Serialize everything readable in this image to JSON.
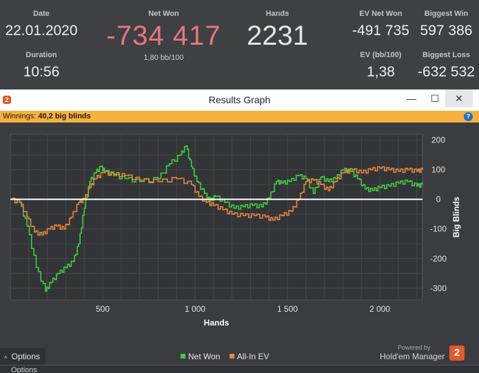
{
  "stats": {
    "date": {
      "label": "Date",
      "value": "22.01.2020"
    },
    "duration": {
      "label": "Duration",
      "value": "10:56"
    },
    "net_won": {
      "label": "Net Won",
      "value": "-734 417",
      "sub": "1,80 bb/100"
    },
    "hands": {
      "label": "Hands",
      "value": "2231"
    },
    "ev_net_won": {
      "label": "EV Net Won",
      "value": "-491 735"
    },
    "biggest_win": {
      "label": "Biggest Win",
      "value": "597 386"
    },
    "ev_bb100": {
      "label": "EV (bb/100)",
      "value": "1,38"
    },
    "biggest_loss": {
      "label": "Biggest Loss",
      "value": "-632 532"
    }
  },
  "window": {
    "title": "Results Graph",
    "app_icon": "2",
    "min_glyph": "—",
    "max_glyph": "☐",
    "close_glyph": "✕"
  },
  "winnings_bar": {
    "label": "Winnings:",
    "value": "40,2 big blinds",
    "help_glyph": "?"
  },
  "legend": {
    "net_won": "Net Won",
    "all_in_ev": "All-In EV"
  },
  "branding": {
    "powered": "Powered by",
    "name": "Hold'em Manager",
    "badge": "2"
  },
  "options": {
    "chevron": "˄",
    "label": "Options"
  },
  "bottom_options": "Options",
  "colors": {
    "net_won": "#3ecf3e",
    "all_in_ev": "#e8873a",
    "negative_value": "#e8767a",
    "accent": "#f6b13c"
  },
  "chart_data": {
    "type": "line",
    "xlabel": "Hands",
    "ylabel": "Big Blinds",
    "xlim": [
      0,
      2231
    ],
    "ylim": [
      -340,
      220
    ],
    "xticks": [
      500,
      1000,
      1500,
      2000
    ],
    "xtick_labels": [
      "500",
      "1 000",
      "1 500",
      "2 000"
    ],
    "yticks": [
      200,
      100,
      0,
      -100,
      -200,
      -300
    ],
    "grid": true,
    "legend_position": "bottom",
    "series": [
      {
        "name": "Net Won",
        "color": "#3ecf3e",
        "x": [
          0,
          50,
          90,
          140,
          190,
          220,
          260,
          300,
          340,
          370,
          400,
          430,
          460,
          490,
          510,
          560,
          620,
          700,
          800,
          860,
          920,
          950,
          980,
          1010,
          1050,
          1080,
          1110,
          1160,
          1210,
          1260,
          1310,
          1360,
          1400,
          1440,
          1470,
          1510,
          1560,
          1600,
          1640,
          1680,
          1720,
          1760,
          1800,
          1840,
          1880,
          1920,
          1960,
          2000,
          2050,
          2100,
          2150,
          2200,
          2231
        ],
        "y": [
          0,
          -10,
          -90,
          -230,
          -310,
          -280,
          -250,
          -230,
          -210,
          -150,
          -30,
          60,
          90,
          110,
          95,
          80,
          70,
          60,
          70,
          120,
          150,
          180,
          110,
          60,
          20,
          -5,
          10,
          -10,
          -30,
          -25,
          -20,
          -25,
          5,
          60,
          55,
          60,
          80,
          70,
          20,
          75,
          60,
          70,
          100,
          95,
          70,
          35,
          30,
          40,
          45,
          55,
          60,
          45,
          50
        ]
      },
      {
        "name": "All-In EV",
        "color": "#e8873a",
        "x": [
          0,
          50,
          90,
          130,
          170,
          210,
          250,
          290,
          330,
          370,
          400,
          430,
          460,
          500,
          560,
          620,
          700,
          800,
          900,
          980,
          1020,
          1060,
          1100,
          1150,
          1200,
          1260,
          1320,
          1380,
          1420,
          1470,
          1520,
          1560,
          1600,
          1640,
          1680,
          1720,
          1760,
          1800,
          1850,
          1900,
          1950,
          2000,
          2050,
          2100,
          2150,
          2200,
          2231
        ],
        "y": [
          0,
          -10,
          -60,
          -110,
          -120,
          -100,
          -90,
          -100,
          -60,
          -10,
          0,
          40,
          70,
          90,
          85,
          80,
          65,
          60,
          70,
          50,
          10,
          -10,
          -20,
          -35,
          -50,
          -55,
          -55,
          -60,
          -70,
          -55,
          -40,
          0,
          60,
          65,
          50,
          30,
          60,
          90,
          100,
          90,
          100,
          105,
          100,
          95,
          100,
          95,
          100
        ]
      }
    ]
  }
}
